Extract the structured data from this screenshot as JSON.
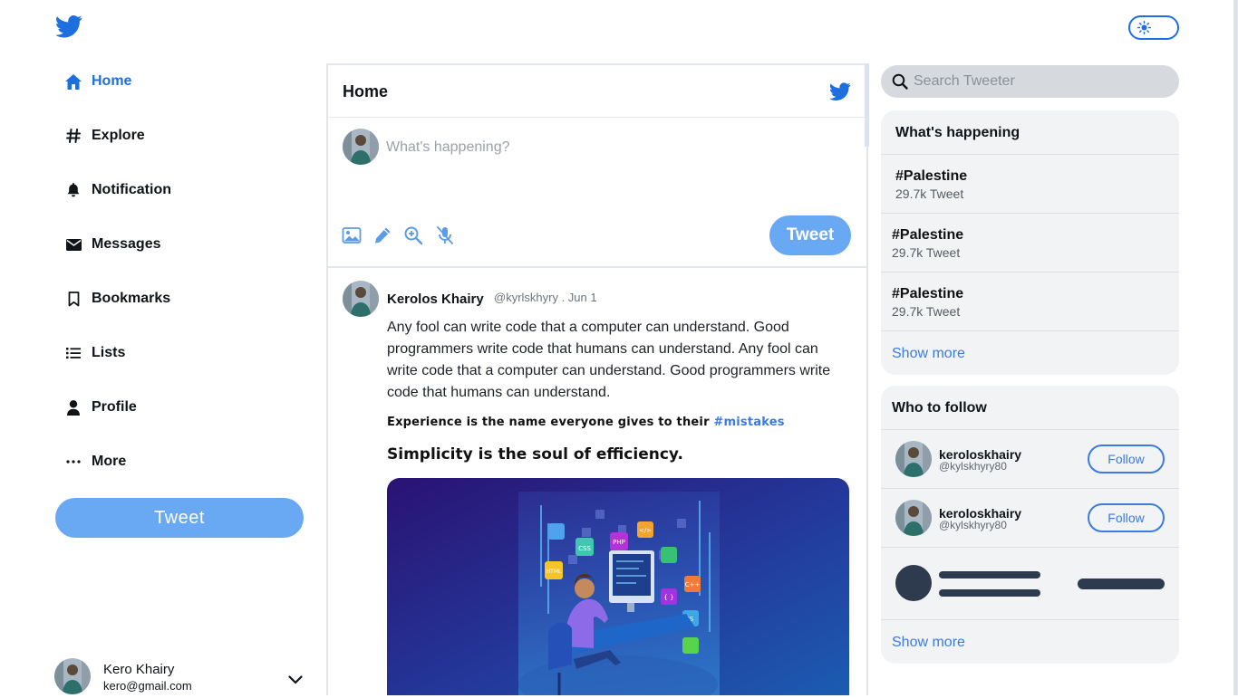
{
  "app": {
    "logo_icon": "twitter-bird-icon",
    "theme_toggle_icon": "sun-icon",
    "brand_color": "#1d6fe0"
  },
  "sidebar": {
    "items": [
      {
        "label": "Home",
        "icon": "home-icon",
        "active": true
      },
      {
        "label": "Explore",
        "icon": "hashtag-icon"
      },
      {
        "label": "Notification",
        "icon": "bell-icon"
      },
      {
        "label": "Messages",
        "icon": "envelope-icon"
      },
      {
        "label": "Bookmarks",
        "icon": "bookmark-icon"
      },
      {
        "label": "Lists",
        "icon": "list-icon"
      },
      {
        "label": "Profile",
        "icon": "user-icon"
      },
      {
        "label": "More",
        "icon": "ellipsis-icon"
      }
    ],
    "tweet_button": "Tweet",
    "account": {
      "name": "Kero Khairy",
      "email": "kero@gmail.com"
    }
  },
  "feed": {
    "title": "Home",
    "composer": {
      "placeholder": "What's happening?",
      "tweet_button": "Tweet"
    },
    "post": {
      "author": "Kerolos Khairy",
      "handle_date": "@kyrlskhyry . Jun 1",
      "body": "Any fool can write code that a computer can understand. Good programmers write code that humans can understand. Any fool can write code that a computer can understand. Good programmers write code that humans can understand.",
      "quote_text": "Experience is the name everyone gives to their ",
      "quote_tag": "#mistakes",
      "motto": "Simplicity is the soul of efficiency.",
      "image_tiles": [
        "CSS",
        "PHP",
        "HTML",
        "C++",
        "JS",
        "{ }",
        "</>"
      ]
    }
  },
  "right": {
    "search_placeholder": "Search Tweeter",
    "happening": {
      "title": "What's happening",
      "trends": [
        {
          "tag": "#Palestine",
          "count": "29.7k Tweet"
        },
        {
          "tag": "#Palestine",
          "count": "29.7k Tweet"
        },
        {
          "tag": "#Palestine",
          "count": "29.7k Tweet"
        }
      ],
      "show_more": "Show more"
    },
    "follow": {
      "title": "Who to follow",
      "users": [
        {
          "name": "keroloskhairy",
          "handle": "@kylskhyry80",
          "button": "Follow"
        },
        {
          "name": "keroloskhairy",
          "handle": "@kylskhyry80",
          "button": "Follow"
        }
      ],
      "show_more": "Show more"
    }
  }
}
